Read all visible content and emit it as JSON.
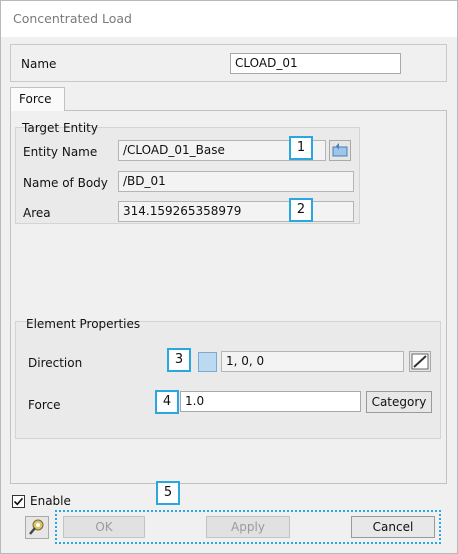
{
  "window": {
    "title": "Concentrated Load"
  },
  "name_field": {
    "label": "Name",
    "value": "CLOAD_01"
  },
  "tabs": [
    {
      "label": "Force",
      "active": true
    }
  ],
  "target_entity": {
    "title": "Target Entity",
    "entity_name": {
      "label": "Entity Name",
      "value": "/CLOAD_01_Base"
    },
    "name_of_body": {
      "label": "Name of Body",
      "value": "/BD_01"
    },
    "area": {
      "label": "Area",
      "value": "314.159265358979"
    }
  },
  "element_properties": {
    "title": "Element Properties",
    "direction": {
      "label": "Direction",
      "value": "1, 0, 0"
    },
    "force": {
      "label": "Force",
      "value": "1.0"
    },
    "category_button": "Category"
  },
  "enable": {
    "label": "Enable",
    "checked": true
  },
  "buttons": {
    "ok": "OK",
    "apply": "Apply",
    "cancel": "Cancel"
  },
  "callouts": [
    "1",
    "2",
    "3",
    "4",
    "5"
  ],
  "colors": {
    "callout_border": "#2aa6e0",
    "swatch": "#bcd9f2"
  }
}
